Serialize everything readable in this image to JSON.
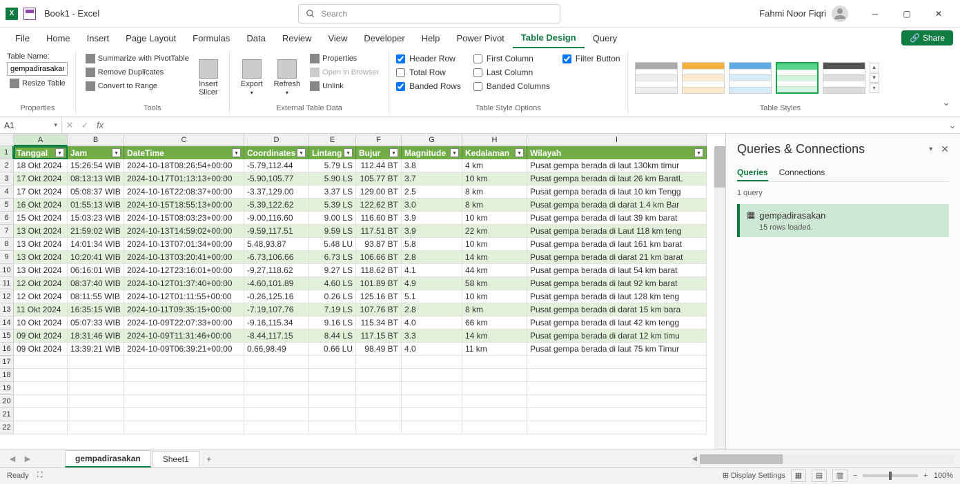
{
  "titlebar": {
    "title": "Book1  -  Excel",
    "search_placeholder": "Search",
    "user": "Fahmi Noor Fiqri"
  },
  "tabs": [
    "File",
    "Home",
    "Insert",
    "Page Layout",
    "Formulas",
    "Data",
    "Review",
    "View",
    "Developer",
    "Help",
    "Power Pivot",
    "Table Design",
    "Query"
  ],
  "active_tab": "Table Design",
  "share": "Share",
  "ribbon": {
    "properties": {
      "label": "Properties",
      "table_name_label": "Table Name:",
      "table_name": "gempadirasakan",
      "resize": "Resize Table"
    },
    "tools": {
      "label": "Tools",
      "summarize": "Summarize with PivotTable",
      "remove_dup": "Remove Duplicates",
      "convert": "Convert to Range",
      "slicer": "Insert\nSlicer"
    },
    "external": {
      "label": "External Table Data",
      "export": "Export",
      "refresh": "Refresh",
      "properties": "Properties",
      "open_browser": "Open in Browser",
      "unlink": "Unlink"
    },
    "style_opts": {
      "label": "Table Style Options",
      "header_row": "Header Row",
      "total_row": "Total Row",
      "banded_rows": "Banded Rows",
      "first_col": "First Column",
      "last_col": "Last Column",
      "banded_cols": "Banded Columns",
      "filter": "Filter Button"
    },
    "styles": {
      "label": "Table Styles"
    }
  },
  "name_box": "A1",
  "columns": [
    "A",
    "B",
    "C",
    "D",
    "E",
    "F",
    "G",
    "H",
    "I"
  ],
  "headers": [
    "Tanggal",
    "Jam",
    "DateTime",
    "Coordinates",
    "Lintang",
    "Bujur",
    "Magnitude",
    "Kedalaman",
    "Wilayah"
  ],
  "rows": [
    [
      "18 Okt 2024",
      "15:26:54 WIB",
      "2024-10-18T08:26:54+00:00",
      "-5.79,112.44",
      "5.79 LS",
      "112.44 BT",
      "3.8",
      "4 km",
      "Pusat gempa berada di laut 130km timur"
    ],
    [
      "17 Okt 2024",
      "08:13:13 WIB",
      "2024-10-17T01:13:13+00:00",
      "-5.90,105.77",
      "5.90 LS",
      "105.77 BT",
      "3.7",
      "10 km",
      "Pusat gempa berada di laut 26 km BaratL"
    ],
    [
      "17 Okt 2024",
      "05:08:37 WIB",
      "2024-10-16T22:08:37+00:00",
      "-3.37,129.00",
      "3.37 LS",
      "129.00 BT",
      "2.5",
      "8 km",
      "Pusat gempa berada di laut 10 km Tengg"
    ],
    [
      "16 Okt 2024",
      "01:55:13 WIB",
      "2024-10-15T18:55:13+00:00",
      "-5.39,122.62",
      "5.39 LS",
      "122.62 BT",
      "3.0",
      "8 km",
      "Pusat gempa berada di darat 1.4 km Bar"
    ],
    [
      "15 Okt 2024",
      "15:03:23 WIB",
      "2024-10-15T08:03:23+00:00",
      "-9.00,116.60",
      "9.00 LS",
      "116.60 BT",
      "3.9",
      "10 km",
      "Pusat gempa berada di laut 39 km barat"
    ],
    [
      "13 Okt 2024",
      "21:59:02 WIB",
      "2024-10-13T14:59:02+00:00",
      "-9.59,117.51",
      "9.59 LS",
      "117.51 BT",
      "3.9",
      "22 km",
      "Pusat gempa berada di Laut 118 km teng"
    ],
    [
      "13 Okt 2024",
      "14:01:34 WIB",
      "2024-10-13T07:01:34+00:00",
      "5.48,93.87",
      "5.48 LU",
      "93.87 BT",
      "5.8",
      "10 km",
      "Pusat gempa berada di laut 161 km barat"
    ],
    [
      "13 Okt 2024",
      "10:20:41 WIB",
      "2024-10-13T03:20:41+00:00",
      "-6.73,106.66",
      "6.73 LS",
      "106.66 BT",
      "2.8",
      "14 km",
      "Pusat gempa berada di darat 21 km barat"
    ],
    [
      "13 Okt 2024",
      "06:16:01 WIB",
      "2024-10-12T23:16:01+00:00",
      "-9.27,118.62",
      "9.27 LS",
      "118.62 BT",
      "4.1",
      "44 km",
      "Pusat gempa berada di laut 54 km barat"
    ],
    [
      "12 Okt 2024",
      "08:37:40 WIB",
      "2024-10-12T01:37:40+00:00",
      "-4.60,101.89",
      "4.60 LS",
      "101.89 BT",
      "4.9",
      "58 km",
      "Pusat gempa berada di laut 92 km barat"
    ],
    [
      "12 Okt 2024",
      "08:11:55 WIB",
      "2024-10-12T01:11:55+00:00",
      "-0.26,125.16",
      "0.26 LS",
      "125.16 BT",
      "5.1",
      "10 km",
      "Pusat gempa berada di laut 128 km teng"
    ],
    [
      "11 Okt 2024",
      "16:35:15 WIB",
      "2024-10-11T09:35:15+00:00",
      "-7.19,107.76",
      "7.19 LS",
      "107.76 BT",
      "2.8",
      "8 km",
      "Pusat gempa berada di darat 15 km bara"
    ],
    [
      "10 Okt 2024",
      "05:07:33 WIB",
      "2024-10-09T22:07:33+00:00",
      "-9.16,115.34",
      "9.16 LS",
      "115.34 BT",
      "4.0",
      "66 km",
      "Pusat gempa berada di laut 42 km tengg"
    ],
    [
      "09 Okt 2024",
      "18:31:46 WIB",
      "2024-10-09T11:31:46+00:00",
      "-8.44,117.15",
      "8.44 LS",
      "117.15 BT",
      "3.3",
      "14 km",
      "Pusat gempa berada di darat 12 km timu"
    ],
    [
      "09 Okt 2024",
      "13:39:21 WIB",
      "2024-10-09T06:39:21+00:00",
      "0.66,98.49",
      "0.66 LU",
      "98.49 BT",
      "4.0",
      "11 km",
      "Pusat gempa berada di laut 75 km Timur"
    ]
  ],
  "side": {
    "title": "Queries & Connections",
    "tabs": [
      "Queries",
      "Connections"
    ],
    "count": "1 query",
    "query_name": "gempadirasakan",
    "query_status": "15 rows loaded."
  },
  "sheet_tabs": [
    "gempadirasakan",
    "Sheet1"
  ],
  "status": {
    "ready": "Ready",
    "display": "Display Settings",
    "zoom": "100%"
  }
}
